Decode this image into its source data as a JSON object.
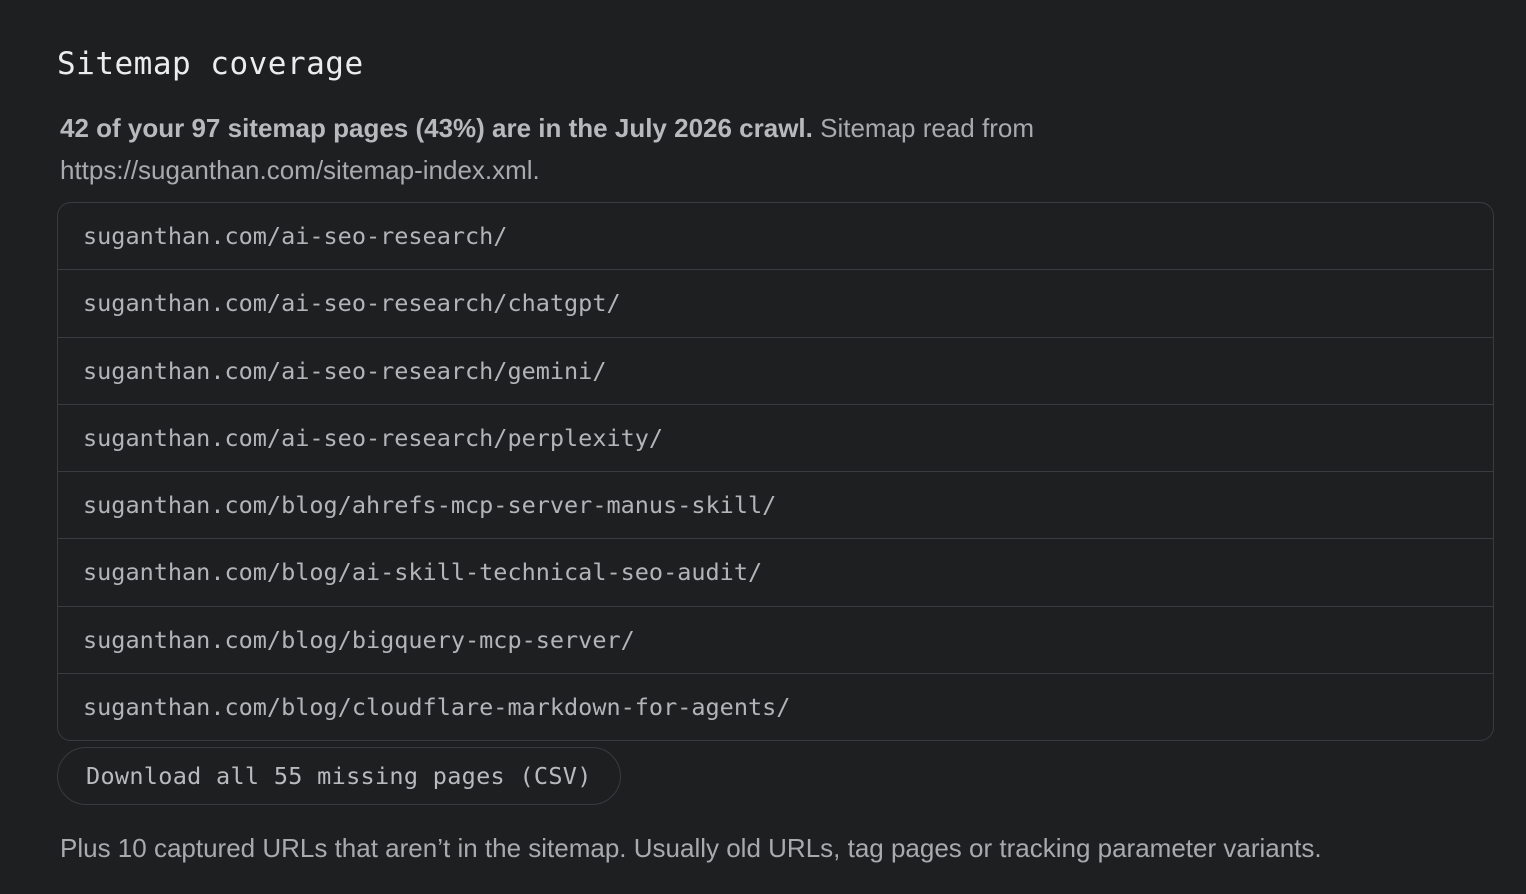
{
  "section": {
    "title": "Sitemap coverage",
    "summary_lead": "42 of your 97 sitemap pages (43%) are in the July 2026 crawl.",
    "summary_rest": "Sitemap read from https://suganthan.com/sitemap-index.xml."
  },
  "urls": [
    "suganthan.com/ai-seo-research/",
    "suganthan.com/ai-seo-research/chatgpt/",
    "suganthan.com/ai-seo-research/gemini/",
    "suganthan.com/ai-seo-research/perplexity/",
    "suganthan.com/blog/ahrefs-mcp-server-manus-skill/",
    "suganthan.com/blog/ai-skill-technical-seo-audit/",
    "suganthan.com/blog/bigquery-mcp-server/",
    "suganthan.com/blog/cloudflare-markdown-for-agents/"
  ],
  "download_button": "Download all 55 missing pages (CSV)",
  "footnote": "Plus 10 captured URLs that aren’t in the sitemap. Usually old URLs, tag pages or tracking parameter variants."
}
